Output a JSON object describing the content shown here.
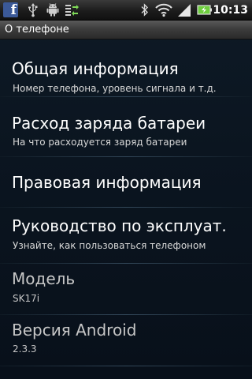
{
  "status_bar": {
    "time": "10:13",
    "icons": [
      "facebook-notification-icon",
      "usb-icon",
      "android-debug-icon",
      "sync-icon",
      "bluetooth-icon",
      "wifi-icon",
      "signal-icon",
      "battery-charging-icon"
    ]
  },
  "title_bar": {
    "title": "О телефоне"
  },
  "items": [
    {
      "title": "Общая информация",
      "subtitle": "Номер телефона, уровень сигнала и т.д."
    },
    {
      "title": "Расход заряда батареи",
      "subtitle": "На что расходуется заряд батареи"
    },
    {
      "title": "Правовая информация",
      "subtitle": ""
    },
    {
      "title": "Руководство по эксплуат.",
      "subtitle": "Узнайте, как пользоваться телефоном"
    },
    {
      "title": "Модель",
      "subtitle": "SK17i"
    },
    {
      "title": "Версия Android",
      "subtitle": "2.3.3"
    }
  ],
  "colors": {
    "background": "#0b1520",
    "facebook_blue": "#3b5998",
    "battery_green": "#6fcf3f"
  }
}
